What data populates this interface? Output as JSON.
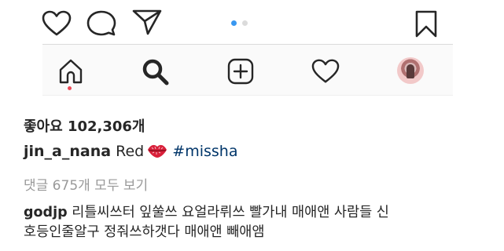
{
  "post": {
    "likes_text": "좋아요 102,306개",
    "caption": {
      "username": "jin_a_nana",
      "text": "Red",
      "emoji_icon": "kiss-mark-icon",
      "hashtag": "#missha"
    },
    "view_comments_text": "댓글 675개 모두 보기",
    "comment": {
      "username": "godjp",
      "line1": "리틀씨쓰터 잎쑬쓰 요얼라뤼쓰 빨가내 매애앤 사람들 신",
      "line2": "호등인줄알구 정줘쓰하갯다 매애앤 빼애앰"
    }
  },
  "action_icons": [
    "heart-icon",
    "comment-icon",
    "share-icon",
    "bookmark-icon"
  ],
  "carousel": {
    "current": 1,
    "total": 2
  },
  "tab_icons": [
    "home-icon",
    "search-icon",
    "add-post-icon",
    "activity-heart-icon",
    "profile-avatar"
  ],
  "colors": {
    "text": "#262626",
    "muted": "#999999",
    "hashtag": "#003569",
    "active_dot": "#3897f0",
    "inactive_dot": "#dbdbdb",
    "notification": "#ed4956",
    "tabbar_bg": "#fafafa"
  }
}
